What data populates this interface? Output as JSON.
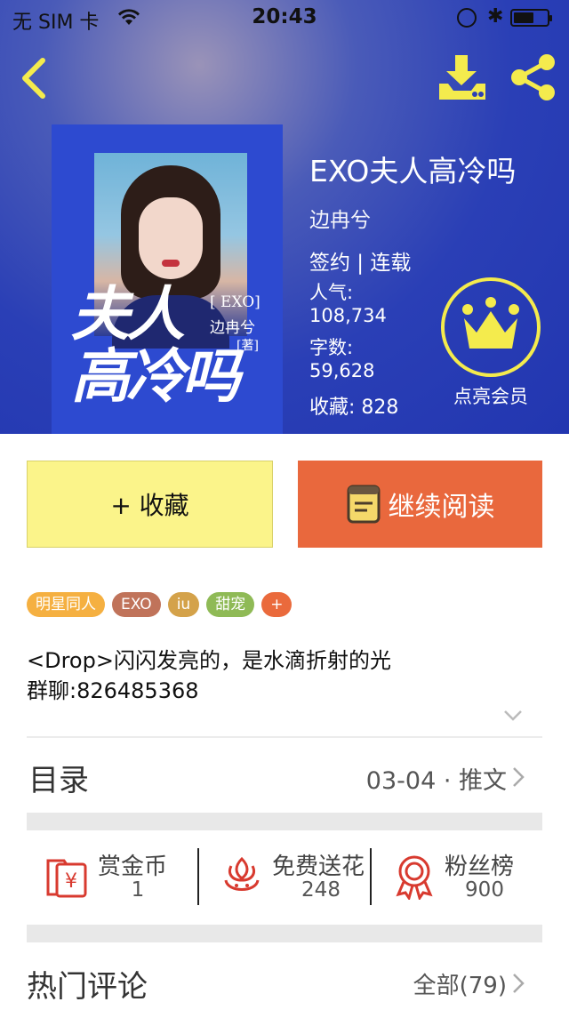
{
  "status_bar": {
    "carrier": "无 SIM 卡",
    "time": "20:43",
    "bluetooth": "✱"
  },
  "header": {
    "back_icon": "chevron-left-icon",
    "download_icon": "download-icon",
    "share_icon": "share-icon"
  },
  "cover": {
    "title_line1": "夫人",
    "title_line2": "高冷吗",
    "tag": "[ EXO]",
    "author": "边冉兮",
    "zhu": "[著]"
  },
  "book": {
    "title": "EXO夫人高冷吗",
    "author": "边冉兮",
    "status": "签约 | 连载",
    "popularity_label": "人气:",
    "popularity_value": "108,734",
    "words_label": "字数:",
    "words_value": "59,628",
    "favorites": "收藏: 828"
  },
  "vip": {
    "label": "点亮会员",
    "icon": "crown-icon"
  },
  "actions": {
    "favorite": "+ 收藏",
    "continue_reading": "继续阅读"
  },
  "tags": [
    {
      "label": "明星同人",
      "color": "#f5b041"
    },
    {
      "label": "EXO",
      "color": "#c0735a"
    },
    {
      "label": "iu",
      "color": "#d4a24a"
    },
    {
      "label": "甜宠",
      "color": "#8fba56"
    },
    {
      "label": "+",
      "color": "#ea6a3c"
    }
  ],
  "description": {
    "line1": "<Drop>闪闪发亮的，是水滴折射的光",
    "line2": "群聊:826485368"
  },
  "toc": {
    "label": "目录",
    "latest": "03-04 · 推文"
  },
  "rewards": [
    {
      "label": "赏金币",
      "value": "1",
      "icon": "red-envelope-yen-icon"
    },
    {
      "label": "免费送花",
      "value": "248",
      "icon": "flower-icon"
    },
    {
      "label": "粉丝榜",
      "value": "900",
      "icon": "medal-icon"
    }
  ],
  "comments": {
    "label": "热门评论",
    "all": "全部(79)"
  },
  "colors": {
    "hero_blue": "#2a3fb6",
    "accent_yellow": "#f4eb4d",
    "read_orange": "#e9683d",
    "reward_red": "#d83a2f"
  }
}
